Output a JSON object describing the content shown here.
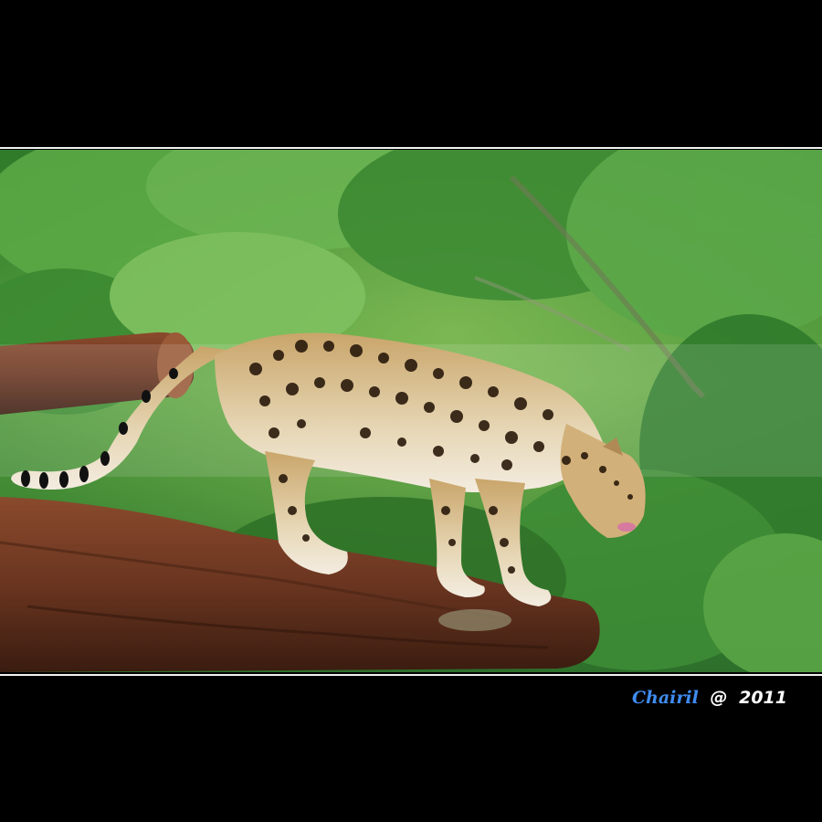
{
  "signature": {
    "name": "Chairil",
    "symbol": "@",
    "year": "2011"
  },
  "colors": {
    "background": "#000000",
    "frame_rule": "#f2f2f2",
    "signature_name": "#3f8cf0",
    "signature_rest": "#ffffff"
  }
}
